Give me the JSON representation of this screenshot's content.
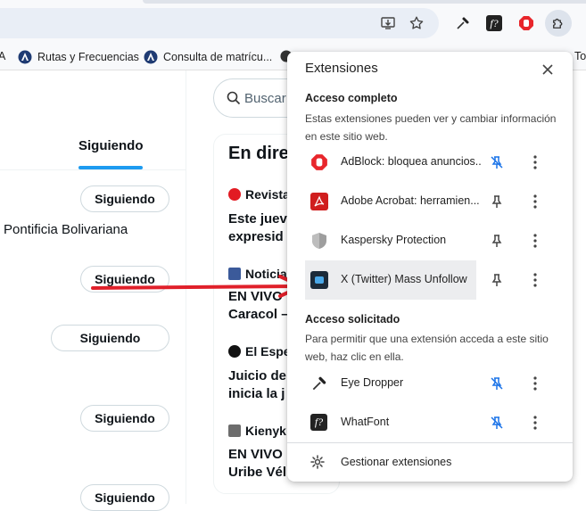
{
  "bookmarks": [
    {
      "label": "A"
    },
    {
      "label": "Rutas y Frecuencias"
    },
    {
      "label": "Consulta de matrícu..."
    },
    {
      "label": "To"
    }
  ],
  "left_column": {
    "tab_following": "Siguiendo",
    "profile_text": "Pontificia Bolivariana",
    "follow_buttons": [
      "Siguiendo",
      "Siguiendo",
      "Siguiendo",
      "Siguiendo",
      "Siguiendo"
    ]
  },
  "search": {
    "placeholder": "Buscar"
  },
  "live": {
    "title": "En dire",
    "items": [
      {
        "source": "Revista",
        "line1": "Este juev",
        "line2": "expresid"
      },
      {
        "source": "Noticia",
        "line1": "EN VIVO",
        "line2": "Caracol –"
      },
      {
        "source": "El Espe",
        "line1": "Juicio de",
        "line2": "inicia la j"
      },
      {
        "source": "Kienyk",
        "line1": "EN VIVO I",
        "line2": "Uribe Vél"
      }
    ]
  },
  "popup": {
    "title": "Extensiones",
    "full_access": {
      "heading": "Acceso completo",
      "desc_line1": "Estas extensiones pueden ver y cambiar información",
      "desc_line2": "en este sitio web.",
      "items": [
        {
          "name": "AdBlock: bloquea anuncios...",
          "icon": "adblock-icon",
          "pinned": true
        },
        {
          "name": "Adobe Acrobat: herramien...",
          "icon": "acrobat-icon",
          "pinned": false
        },
        {
          "name": "Kaspersky Protection",
          "icon": "kaspersky-icon",
          "pinned": false
        },
        {
          "name": "X (Twitter) Mass Unfollow",
          "icon": "mass-unfollow-icon",
          "pinned": false
        }
      ]
    },
    "requested_access": {
      "heading": "Acceso solicitado",
      "desc_line1": "Para permitir que una extensión acceda a este sitio",
      "desc_line2": "web, haz clic en ella.",
      "items": [
        {
          "name": "Eye Dropper",
          "icon": "eyedropper-icon",
          "pinned": true
        },
        {
          "name": "WhatFont",
          "icon": "whatfont-icon",
          "pinned": true
        }
      ]
    },
    "manage_label": "Gestionar extensiones"
  },
  "colors": {
    "accent": "#1d9bf0",
    "pin_active": "#1a73e8",
    "arrow": "#e0202a",
    "adblock": "#e8262c"
  }
}
